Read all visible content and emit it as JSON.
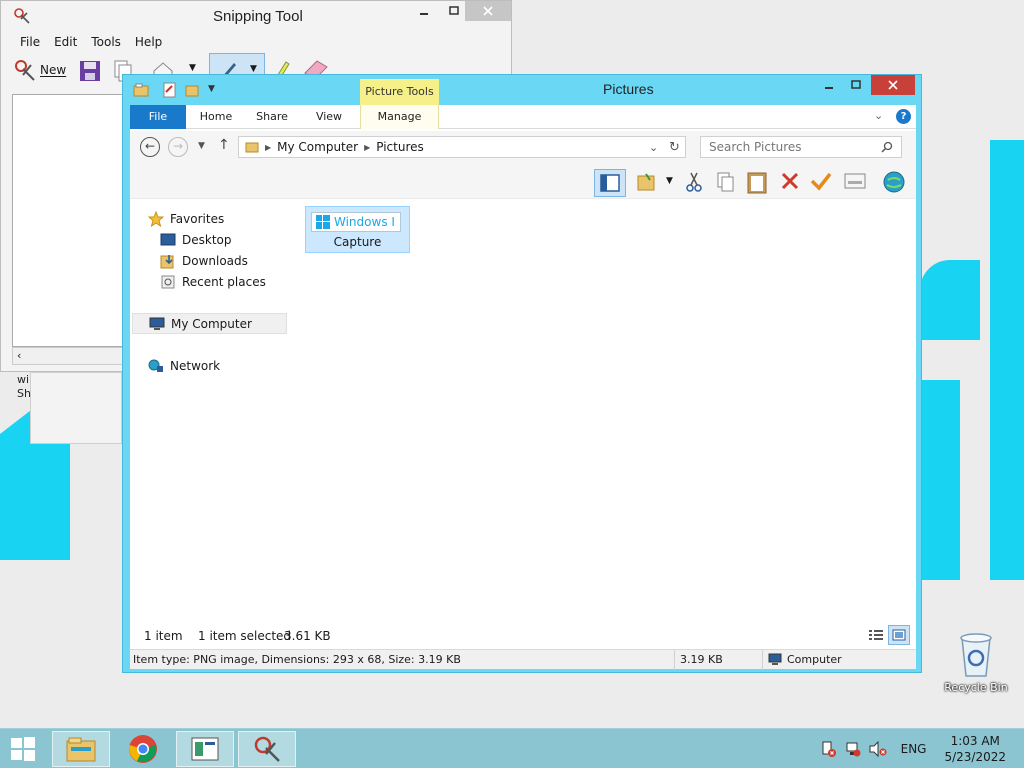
{
  "snipping_tool": {
    "title": "Snipping Tool",
    "menu": [
      "File",
      "Edit",
      "Tools",
      "Help"
    ],
    "new_label": "New",
    "partial_text_1": "wi",
    "partial_text_2": "Sh"
  },
  "explorer": {
    "title": "Pictures",
    "context_tab": "Picture Tools",
    "tabs": {
      "file": "File",
      "home": "Home",
      "share": "Share",
      "view": "View",
      "manage": "Manage"
    },
    "breadcrumb": [
      "My Computer",
      "Pictures"
    ],
    "search_placeholder": "Search Pictures",
    "nav": {
      "favorites": "Favorites",
      "desktop": "Desktop",
      "downloads": "Downloads",
      "recent": "Recent places",
      "computer": "My Computer",
      "network": "Network"
    },
    "file": {
      "name": "Capture",
      "thumb_text": "Windows I"
    },
    "status": {
      "items": "1 item",
      "selected": "1 item selected",
      "size": "3.61 KB"
    },
    "details": {
      "info": "Item type: PNG image, Dimensions: 293 x 68, Size: 3.19 KB",
      "size": "3.19 KB",
      "location": "Computer"
    }
  },
  "desktop": {
    "recycle_bin": "Recycle Bin"
  },
  "taskbar": {
    "lang": "ENG",
    "time": "1:03 AM",
    "date": "5/23/2022"
  },
  "colors": {
    "accent": "#1979ca",
    "explorer_frame": "#6ad7f5",
    "close_red": "#c7403a",
    "context_yellow": "#f6f08a",
    "taskbar": "#8bc5d1"
  }
}
